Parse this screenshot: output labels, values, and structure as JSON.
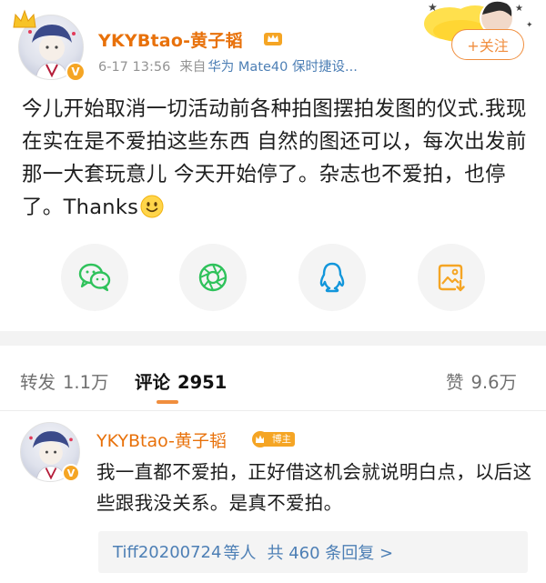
{
  "post": {
    "username": "YKYBtao-黄子韬",
    "date": "6-17 13:56",
    "source_label": "来自",
    "device": "华为 Mate40 保时捷设...",
    "follow_label": "+关注",
    "text": "今儿开始取消一切活动前各种拍图摆拍发图的仪式.我现在实在是不爱拍这些东西 自然的图还可以，每次出发前那一大套玩意儿 今天开始停了。杂志也不爱拍，也停了。Thanks",
    "verified_mark": "V"
  },
  "share": {
    "items": [
      {
        "icon": "wechat-icon"
      },
      {
        "icon": "moments-icon"
      },
      {
        "icon": "qq-icon"
      },
      {
        "icon": "save-image-icon"
      }
    ]
  },
  "tabs": {
    "repost_label": "转发",
    "repost_count": "1.1万",
    "comment_label": "评论",
    "comment_count": "2951",
    "like_label": "赞",
    "like_count": "9.6万"
  },
  "comment": {
    "username": "YKYBtao-黄子韬",
    "badge_label": "博主",
    "text": "我一直都不爱拍，正好借这机会就说明白点，以后这些跟我没关系。是真不爱拍。",
    "reply_names": "Tiff20200724",
    "reply_suffix": "等人",
    "reply_count": "共 460 条回复 >"
  },
  "colors": {
    "accent_orange": "#f08e3e",
    "link_blue": "#4d7fb5",
    "username_orange": "#e8710a",
    "wechat_green": "#2fc25b",
    "moments_green": "#2fc25b",
    "qq_blue": "#1296db",
    "save_orange": "#f5a524"
  }
}
